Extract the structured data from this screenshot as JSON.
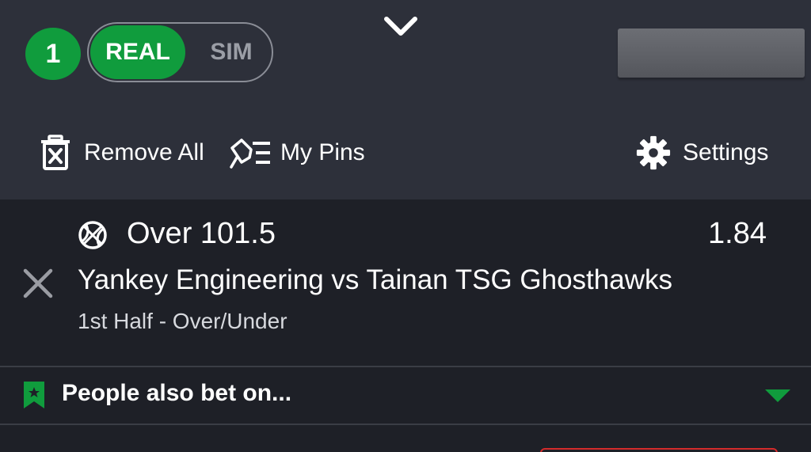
{
  "header": {
    "selection_count": "1",
    "mode_toggle": {
      "real_label": "REAL",
      "sim_label": "SIM",
      "active": "REAL"
    },
    "collapse_icon": "chevron-down-icon"
  },
  "actions": {
    "remove_all_label": "Remove All",
    "my_pins_label": "My Pins",
    "settings_label": "Settings"
  },
  "bet": {
    "sport_icon": "basketball-icon",
    "selection": "Over 101.5",
    "odds": "1.84",
    "match": "Yankey Engineering vs Tainan TSG Ghosthawks",
    "market": "1st Half - Over/Under"
  },
  "also_bet": {
    "label": "People also bet on...",
    "icon": "bookmark-star-icon",
    "expand_icon": "caret-down-icon"
  },
  "colors": {
    "accent_green": "#109c3d",
    "header_bg": "#2d303a",
    "body_bg": "#1e2027",
    "danger_red": "#d52b2b"
  }
}
